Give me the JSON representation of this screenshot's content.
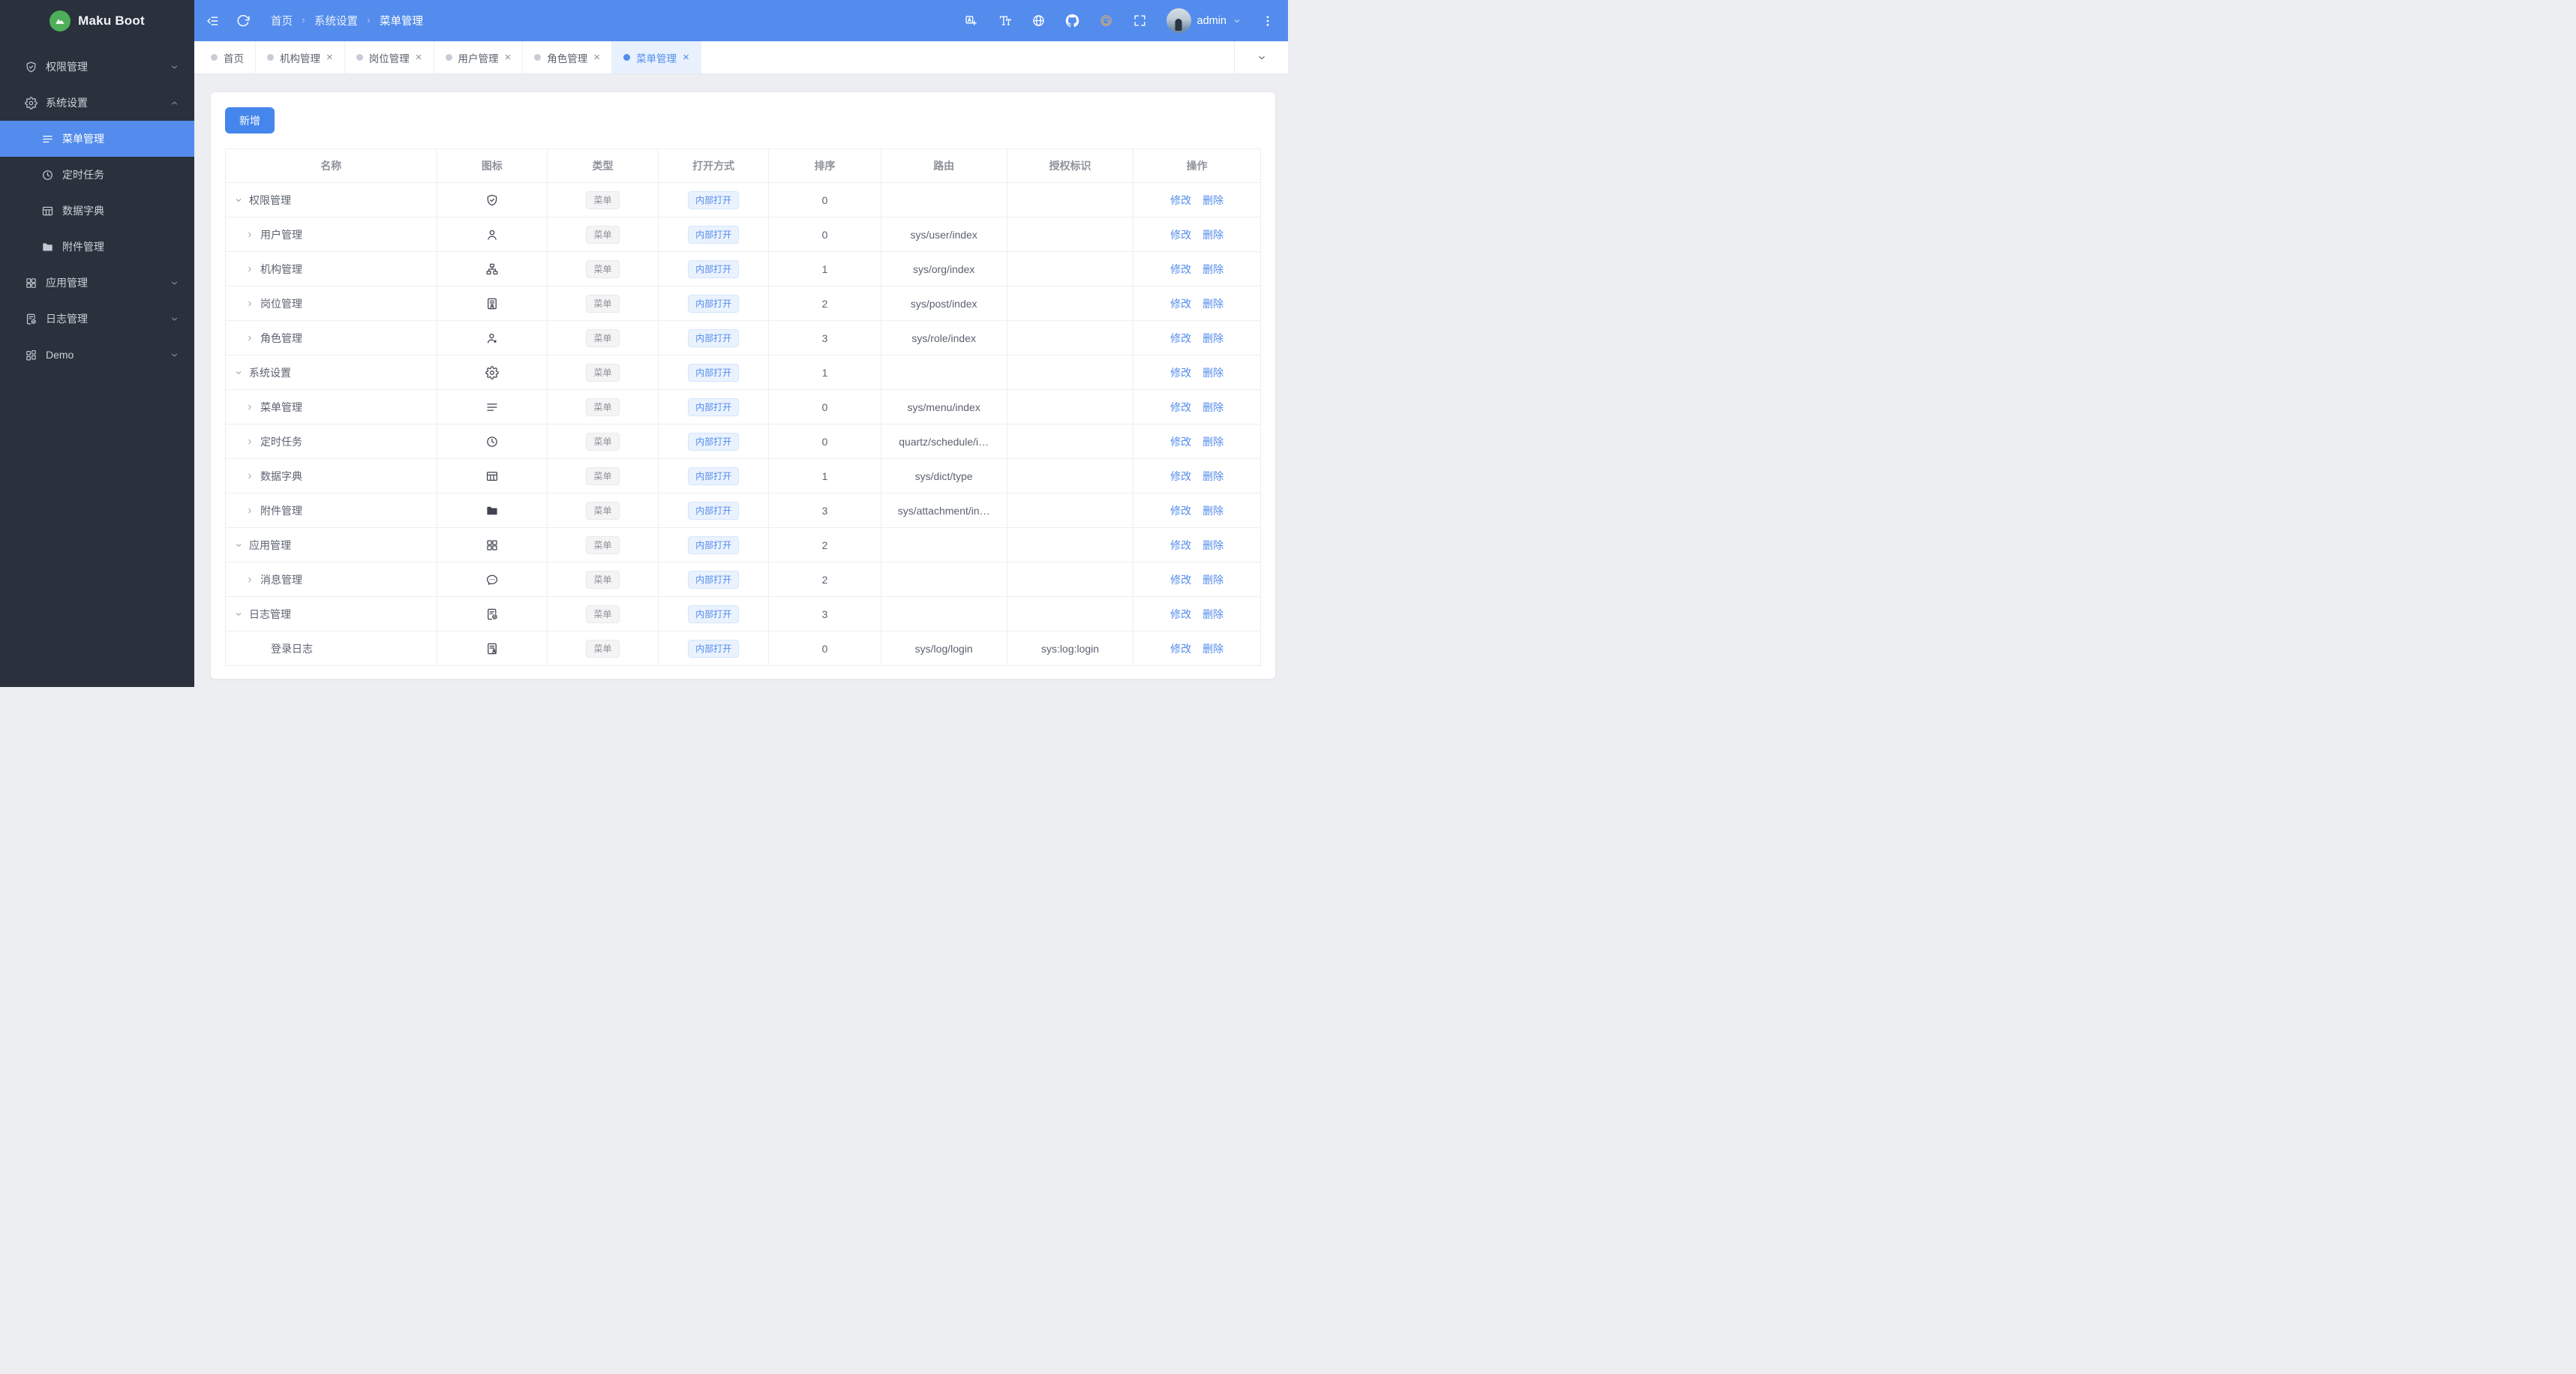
{
  "colors": {
    "brand_blue": "#538CEC",
    "button_blue": "#4586EC",
    "sidebar_bg": "#2A313C",
    "content_bg": "#EDEEF2",
    "active_tab_bg": "#E8F1FD",
    "logo_green": "#4FAE5A",
    "gitee_gold": "#C9A97F",
    "tag_info_text": "#909399",
    "table_border": "#EBEEF5"
  },
  "sidebar": {
    "logo_title": "Maku Boot",
    "items": [
      {
        "label": "权限管理",
        "icon": "shield-check",
        "chevron": "down"
      },
      {
        "label": "系统设置",
        "icon": "gear",
        "chevron": "up",
        "children": [
          {
            "label": "菜单管理",
            "icon": "menu-lines",
            "active": true
          },
          {
            "label": "定时任务",
            "icon": "clock"
          },
          {
            "label": "数据字典",
            "icon": "table-grid"
          },
          {
            "label": "附件管理",
            "icon": "folder"
          }
        ]
      },
      {
        "label": "应用管理",
        "icon": "app-grid",
        "chevron": "down"
      },
      {
        "label": "日志管理",
        "icon": "doc-check",
        "chevron": "down"
      },
      {
        "label": "Demo",
        "icon": "grid-demo",
        "chevron": "down"
      }
    ]
  },
  "topbar": {
    "breadcrumb": [
      "首页",
      "系统设置",
      "菜单管理"
    ],
    "user": "admin",
    "icons": [
      "collapse-sidebar",
      "refresh",
      "translate",
      "font-size",
      "globe",
      "github",
      "gitee",
      "fullscreen",
      "kebab-menu"
    ]
  },
  "tabs": [
    {
      "label": "首页",
      "closable": false,
      "active": false
    },
    {
      "label": "机构管理",
      "closable": true,
      "active": false
    },
    {
      "label": "岗位管理",
      "closable": true,
      "active": false
    },
    {
      "label": "用户管理",
      "closable": true,
      "active": false
    },
    {
      "label": "角色管理",
      "closable": true,
      "active": false
    },
    {
      "label": "菜单管理",
      "closable": true,
      "active": true
    }
  ],
  "ui": {
    "close_glyph": "×"
  },
  "toolbar": {
    "add_label": "新增"
  },
  "table": {
    "columns": [
      "名称",
      "图标",
      "类型",
      "打开方式",
      "排序",
      "路由",
      "授权标识",
      "操作"
    ],
    "type_label": "菜单",
    "open_label": "内部打开",
    "edit_label": "修改",
    "delete_label": "删除",
    "rows": [
      {
        "name": "权限管理",
        "icon": "shield-check",
        "indent": 0,
        "expand": "open",
        "sort": "0",
        "route": "",
        "auth": ""
      },
      {
        "name": "用户管理",
        "icon": "user",
        "indent": 1,
        "expand": "closed",
        "sort": "0",
        "route": "sys/user/index",
        "auth": ""
      },
      {
        "name": "机构管理",
        "icon": "org-tree",
        "indent": 1,
        "expand": "closed",
        "sort": "1",
        "route": "sys/org/index",
        "auth": ""
      },
      {
        "name": "岗位管理",
        "icon": "id-badge",
        "indent": 1,
        "expand": "closed",
        "sort": "2",
        "route": "sys/post/index",
        "auth": ""
      },
      {
        "name": "角色管理",
        "icon": "user-role",
        "indent": 1,
        "expand": "closed",
        "sort": "3",
        "route": "sys/role/index",
        "auth": ""
      },
      {
        "name": "系统设置",
        "icon": "gear",
        "indent": 0,
        "expand": "open",
        "sort": "1",
        "route": "",
        "auth": ""
      },
      {
        "name": "菜单管理",
        "icon": "menu-lines",
        "indent": 1,
        "expand": "closed",
        "sort": "0",
        "route": "sys/menu/index",
        "auth": ""
      },
      {
        "name": "定时任务",
        "icon": "clock",
        "indent": 1,
        "expand": "closed",
        "sort": "0",
        "route": "quartz/schedule/i…",
        "auth": ""
      },
      {
        "name": "数据字典",
        "icon": "table-grid",
        "indent": 1,
        "expand": "closed",
        "sort": "1",
        "route": "sys/dict/type",
        "auth": ""
      },
      {
        "name": "附件管理",
        "icon": "folder",
        "indent": 1,
        "expand": "closed",
        "sort": "3",
        "route": "sys/attachment/in…",
        "auth": ""
      },
      {
        "name": "应用管理",
        "icon": "app-grid",
        "indent": 0,
        "expand": "open",
        "sort": "2",
        "route": "",
        "auth": ""
      },
      {
        "name": "消息管理",
        "icon": "chat-bubble",
        "indent": 1,
        "expand": "closed",
        "sort": "2",
        "route": "",
        "auth": ""
      },
      {
        "name": "日志管理",
        "icon": "doc-check",
        "indent": 0,
        "expand": "open",
        "sort": "3",
        "route": "",
        "auth": ""
      },
      {
        "name": "登录日志",
        "icon": "doc-user",
        "indent": 2,
        "expand": "none",
        "sort": "0",
        "route": "sys/log/login",
        "auth": "sys:log:login"
      }
    ]
  }
}
